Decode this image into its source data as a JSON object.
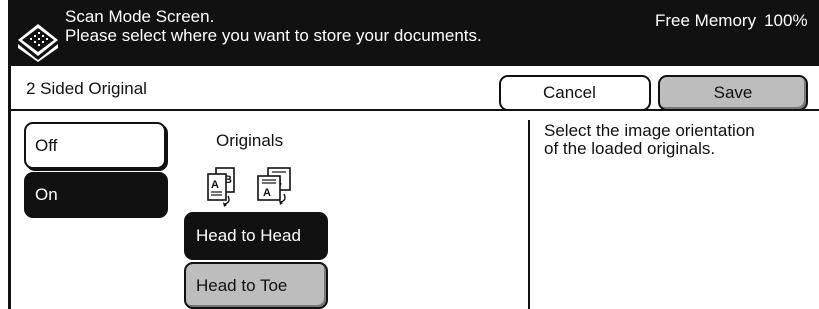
{
  "header": {
    "line1": "Scan Mode Screen.",
    "line2": "Please select where you want to store your documents.",
    "memory_label": "Free Memory",
    "memory_value": "100%",
    "icon": "scanner-icon"
  },
  "feature": {
    "title": "2 Sided Original"
  },
  "actions": {
    "cancel_label": "Cancel",
    "save_label": "Save"
  },
  "options": {
    "off_label": "Off",
    "on_label": "On",
    "selected": "On"
  },
  "originals": {
    "label": "Originals",
    "icon_portrait": "portrait-original-icon",
    "icon_landscape": "landscape-original-icon",
    "head_to_head_label": "Head to Head",
    "head_to_toe_label": "Head to Toe",
    "selected": "Head to Head"
  },
  "help": {
    "line1": "Select the image orientation",
    "line2": "of the loaded originals."
  },
  "colors": {
    "header_bg": "#111111",
    "selected_bg": "#111111",
    "unselected_gray": "#bdbdbd"
  }
}
